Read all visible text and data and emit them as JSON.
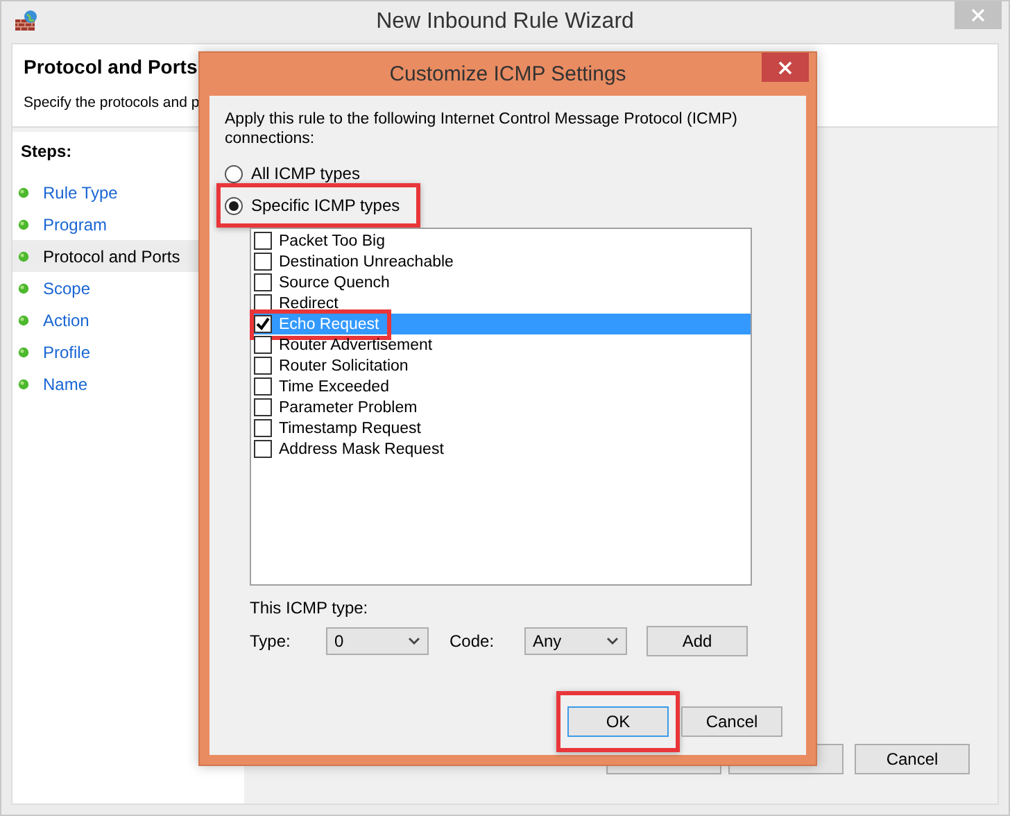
{
  "window": {
    "title": "New Inbound Rule Wizard"
  },
  "header": {
    "title": "Protocol and Ports",
    "subtitle": "Specify the protocols and p"
  },
  "steps": {
    "heading": "Steps:",
    "items": [
      {
        "label": "Rule Type",
        "selected": false
      },
      {
        "label": "Program",
        "selected": false
      },
      {
        "label": "Protocol and Ports",
        "selected": true
      },
      {
        "label": "Scope",
        "selected": false
      },
      {
        "label": "Action",
        "selected": false
      },
      {
        "label": "Profile",
        "selected": false
      },
      {
        "label": "Name",
        "selected": false
      }
    ]
  },
  "wizard_buttons": [
    {
      "kind": "back"
    },
    {
      "kind": "next"
    },
    {
      "kind": "cancel",
      "label": "Cancel"
    }
  ],
  "dialog": {
    "title": "Customize ICMP Settings",
    "intro": "Apply this rule to the following Internet Control Message Protocol (ICMP) connections:",
    "scope_options": [
      {
        "label": "All ICMP types",
        "selected": false,
        "highlighted": false
      },
      {
        "label": "Specific ICMP types",
        "selected": true,
        "highlighted": true
      }
    ],
    "icmp_types": [
      {
        "label": "Packet Too Big",
        "checked": false,
        "selected": false,
        "highlighted": false
      },
      {
        "label": "Destination Unreachable",
        "checked": false,
        "selected": false,
        "highlighted": false
      },
      {
        "label": "Source Quench",
        "checked": false,
        "selected": false,
        "highlighted": false
      },
      {
        "label": "Redirect",
        "checked": false,
        "selected": false,
        "highlighted": false
      },
      {
        "label": "Echo Request",
        "checked": true,
        "selected": true,
        "highlighted": true
      },
      {
        "label": "Router Advertisement",
        "checked": false,
        "selected": false,
        "highlighted": false
      },
      {
        "label": "Router Solicitation",
        "checked": false,
        "selected": false,
        "highlighted": false
      },
      {
        "label": "Time Exceeded",
        "checked": false,
        "selected": false,
        "highlighted": false
      },
      {
        "label": "Parameter Problem",
        "checked": false,
        "selected": false,
        "highlighted": false
      },
      {
        "label": "Timestamp Request",
        "checked": false,
        "selected": false,
        "highlighted": false
      },
      {
        "label": "Address Mask Request",
        "checked": false,
        "selected": false,
        "highlighted": false
      }
    ],
    "this_type": {
      "heading": "This ICMP type:",
      "type_label": "Type:",
      "type_value": "0",
      "code_label": "Code:",
      "code_value": "Any",
      "add_button": "Add"
    },
    "buttons": [
      {
        "label": "OK",
        "default": true,
        "highlighted": true
      },
      {
        "label": "Cancel",
        "default": false,
        "highlighted": false
      }
    ]
  }
}
